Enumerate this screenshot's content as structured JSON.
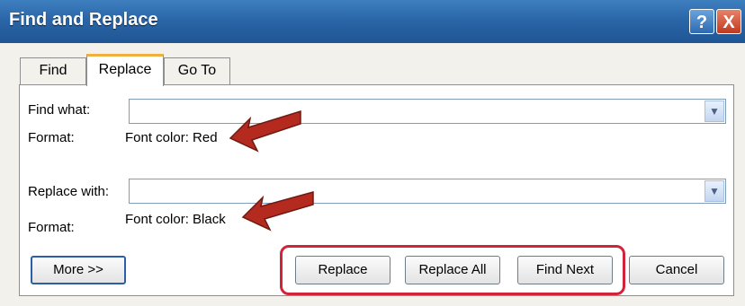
{
  "window": {
    "title": "Find and Replace",
    "help_label": "?",
    "close_label": "X"
  },
  "tabs": [
    {
      "label": "Find"
    },
    {
      "label": "Replace"
    },
    {
      "label": "Go To"
    }
  ],
  "find": {
    "label": "Find what:",
    "value": "",
    "format_label": "Format:",
    "format_value": "Font color: Red"
  },
  "replace": {
    "label": "Replace with:",
    "value": "",
    "format_label": "Format:",
    "format_value": "Font color: Black"
  },
  "buttons": {
    "more": "More >>",
    "replace": "Replace",
    "replace_all": "Replace All",
    "find_next": "Find Next",
    "cancel": "Cancel"
  },
  "icons": {
    "dropdown": "chevron-down-icon"
  },
  "colors": {
    "highlight": "#d1243a",
    "arrow": "#b52a1f",
    "titlebar": "#2a66a8"
  }
}
